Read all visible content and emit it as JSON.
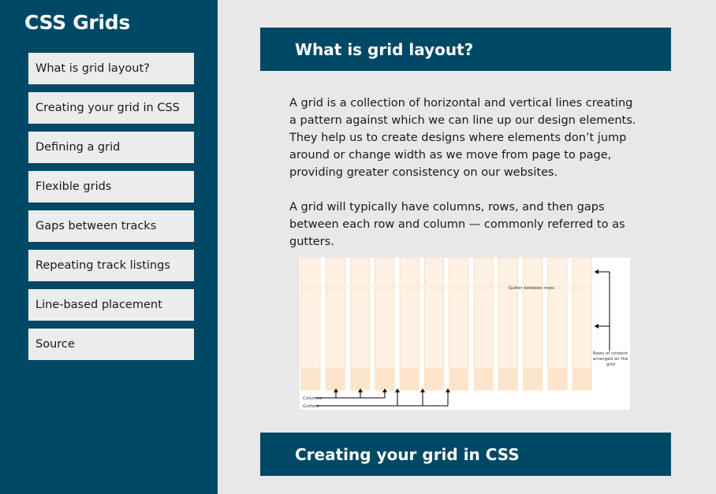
{
  "sidebar": {
    "title": "CSS Grids",
    "items": [
      {
        "label": "What is grid layout?"
      },
      {
        "label": "Creating your grid in CSS"
      },
      {
        "label": "Defining a grid"
      },
      {
        "label": "Flexible grids"
      },
      {
        "label": "Gaps between tracks"
      },
      {
        "label": "Repeating track listings"
      },
      {
        "label": "Line-based placement"
      },
      {
        "label": "Source"
      }
    ]
  },
  "main": {
    "section1": {
      "heading": "What is grid layout?",
      "paragraphs": [
        "A grid is a collection of horizontal and vertical lines creating a pattern against which we can line up our design elements. They help us to create designs where elements don’t jump around or change width as we move from page to page, providing greater consistency on our websites.",
        "A grid will typically have columns, rows, and then gaps between each row and column — commonly referred to as gutters."
      ],
      "figure": {
        "label_gutter_rows": "Gutter between rows",
        "label_rows": [
          "Rows of content",
          "arranged on the",
          "grid"
        ],
        "label_columns": "Columns",
        "label_gutters": "Gutters"
      }
    },
    "section2": {
      "heading": "Creating your grid in CSS"
    }
  },
  "colors": {
    "brand": "#004966",
    "nav_bg": "#ececec",
    "page_bg": "#e8e8e8",
    "column_fill": "#fff2e5",
    "column_stroke": "#f5d6b5",
    "row_band": "#fde5cc"
  }
}
